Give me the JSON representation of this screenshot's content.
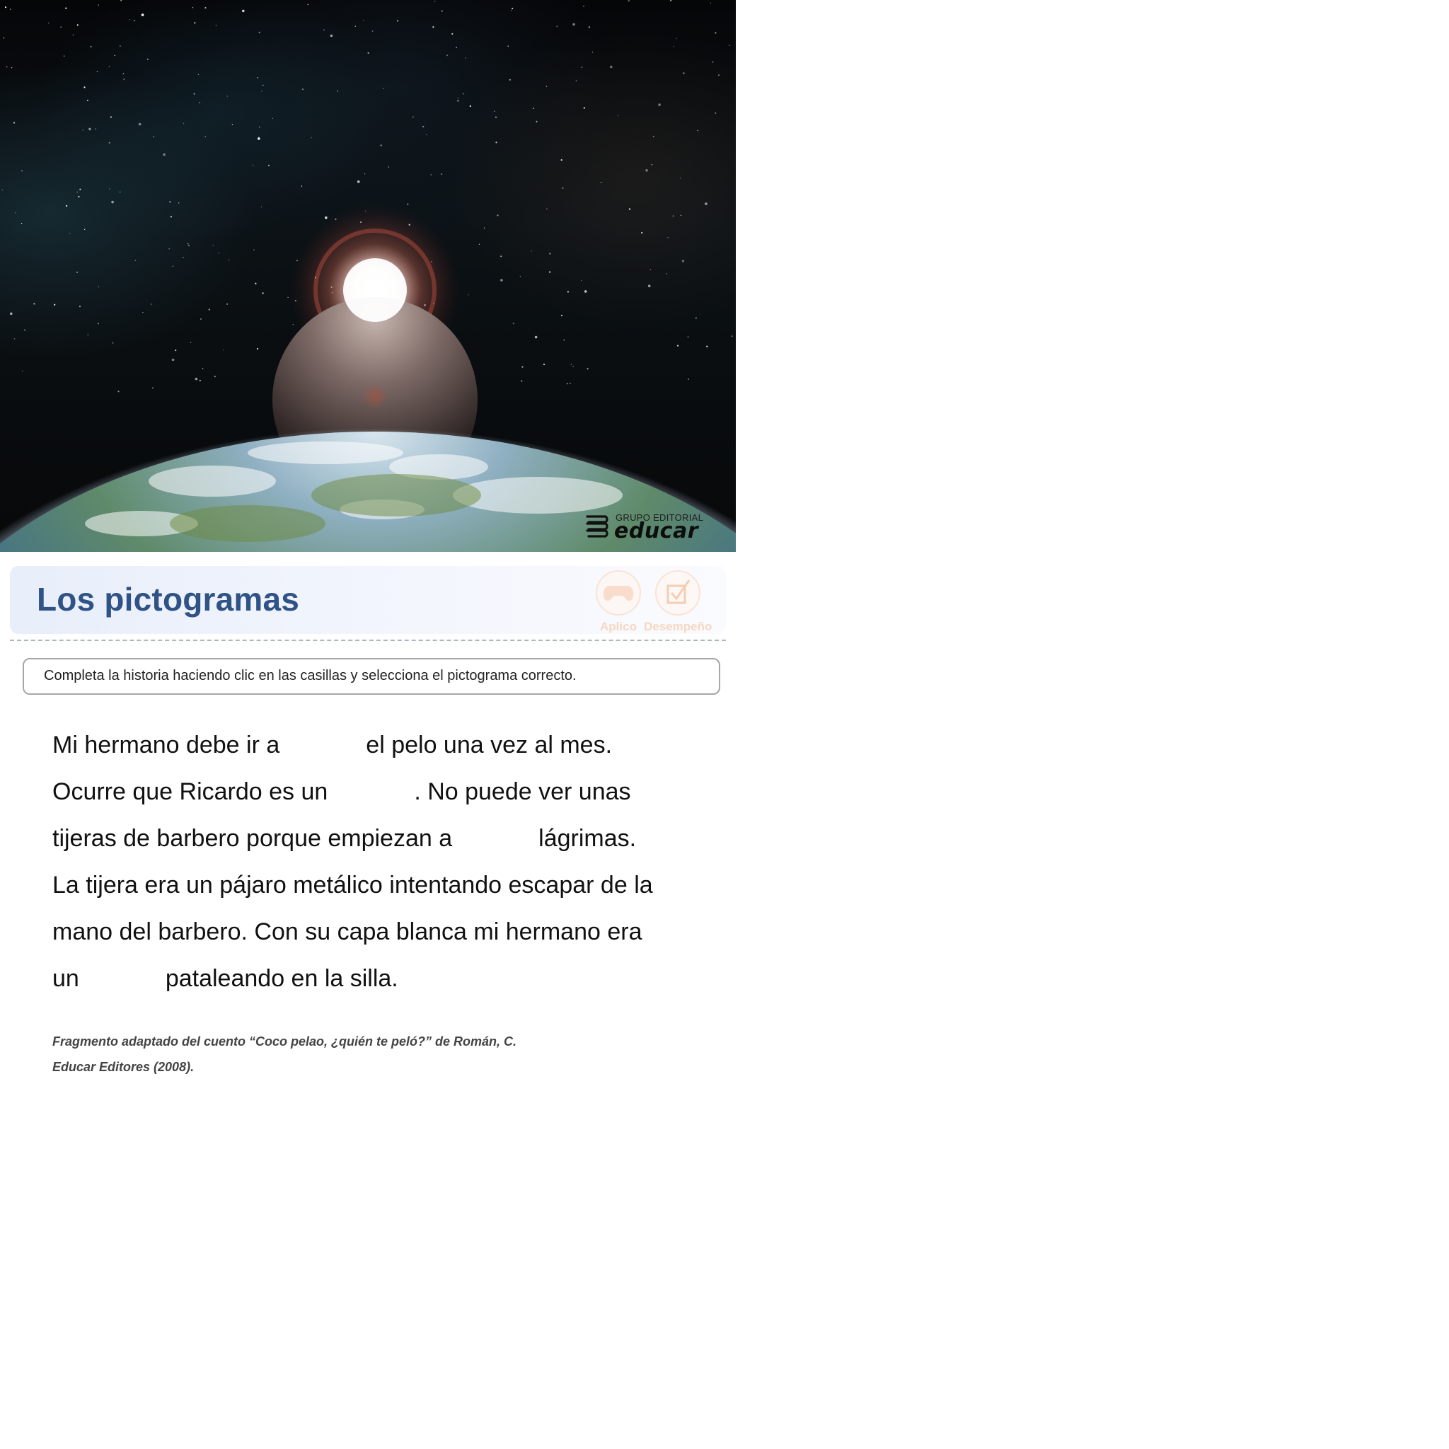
{
  "hero": {
    "publisher_small": "GRUPO EDITORIAL",
    "publisher_big": "educar"
  },
  "header": {
    "title": "Los pictogramas",
    "badges": [
      {
        "label": "Aplico",
        "icon": "gamepad-icon"
      },
      {
        "label": "Desempeño",
        "icon": "checkbox-icon"
      }
    ]
  },
  "instruction": "Completa la historia haciendo clic en las casillas y selecciona el pictograma correcto.",
  "story": {
    "line1": {
      "before": "Mi hermano debe ir a",
      "after": "el pelo una vez al mes."
    },
    "line2": {
      "before": "Ocurre que Ricardo es un",
      "after": ". No puede ver unas"
    },
    "line3": {
      "before": "tijeras de barbero porque empiezan a",
      "after": "lágrimas."
    },
    "line4": {
      "text": "La tijera era un pájaro metálico intentando escapar de la"
    },
    "line5": {
      "text": "mano del barbero.  Con su capa blanca mi hermano era"
    },
    "line6": {
      "before": "un",
      "after": "pataleando en la silla."
    }
  },
  "citation": {
    "line1": "Fragmento adaptado del cuento  “Coco pelao, ¿quién te peló?” de Román, C.",
    "line2": "Educar Editores (2008)."
  },
  "colors": {
    "title": "#2f5385",
    "badge": "#f6d7c1",
    "divider": "#a9b6c8"
  }
}
